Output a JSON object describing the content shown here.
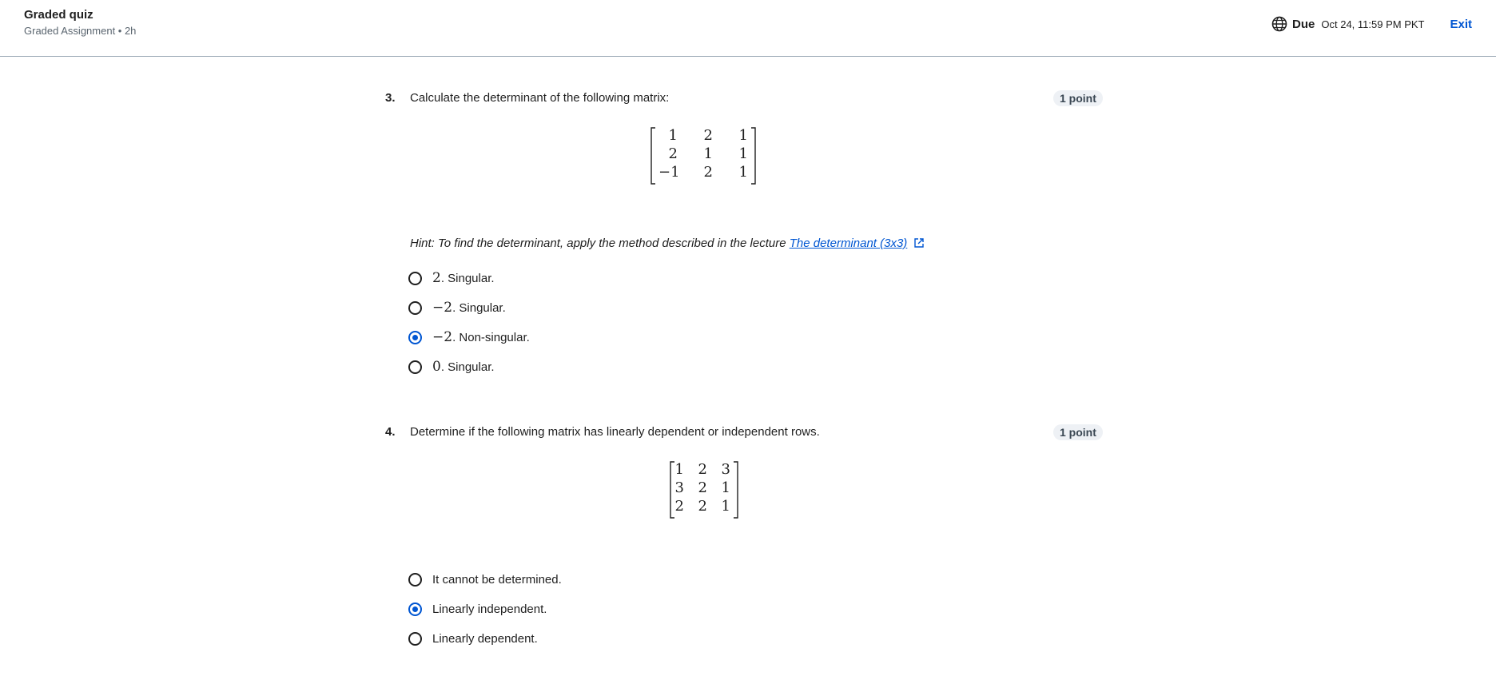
{
  "header": {
    "title": "Graded quiz",
    "subtitle": "Graded Assignment • 2h",
    "due_label": "Due",
    "due_date": "Oct 24, 11:59 PM PKT",
    "exit_label": "Exit"
  },
  "questions": [
    {
      "number": "3.",
      "text": "Calculate the determinant of the following matrix:",
      "points": "1 point",
      "matrix": [
        [
          "1",
          "2",
          "1"
        ],
        [
          "2",
          "1",
          "1"
        ],
        [
          "−1",
          "2",
          "1"
        ]
      ],
      "hint_prefix": "Hint: To find the determinant, apply the method described in the lecture ",
      "hint_link": "The determinant (3x3)",
      "options": [
        {
          "math": "2",
          "text": ". Singular.",
          "selected": false
        },
        {
          "math": "−2",
          "text": ". Singular.",
          "selected": false
        },
        {
          "math": "−2",
          "text": ". Non-singular.",
          "selected": true
        },
        {
          "math": "0",
          "text": ". Singular.",
          "selected": false
        }
      ]
    },
    {
      "number": "4.",
      "text": "Determine if the following matrix has linearly dependent or independent rows.",
      "points": "1 point",
      "matrix": [
        [
          "1",
          "2",
          "3"
        ],
        [
          "3",
          "2",
          "1"
        ],
        [
          "2",
          "2",
          "1"
        ]
      ],
      "options": [
        {
          "text": "It cannot be determined.",
          "selected": false
        },
        {
          "text": "Linearly independent.",
          "selected": true
        },
        {
          "text": "Linearly dependent.",
          "selected": false
        }
      ]
    }
  ],
  "icons": {
    "globe": "globe-icon",
    "external_link": "external-link-icon",
    "radio": "radio-button"
  },
  "colors": {
    "accent": "#0056d2",
    "header_border": "#9aa8b5",
    "points_badge_bg": "#eef1f5"
  }
}
